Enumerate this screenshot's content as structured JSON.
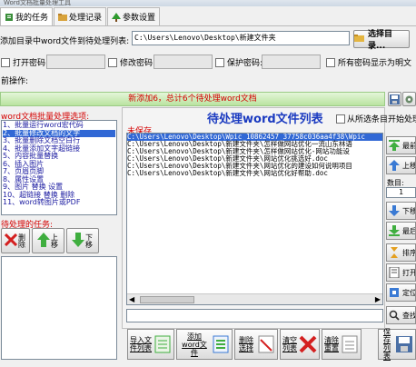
{
  "window": {
    "title": "Word文档批量处理工具"
  },
  "tabs": [
    {
      "label": "我的任务"
    },
    {
      "label": "处理记录"
    },
    {
      "label": "参数设置"
    }
  ],
  "add_dir": {
    "label": "添加目录中word文件到待处理列表:",
    "path": "C:\\Users\\Lenovo\\Desktop\\新建文件夹",
    "select_button": "选择目录..."
  },
  "passwords": {
    "open_label": "打开密码:",
    "modify_label": "修改密码:",
    "protect_label": "保护密码:",
    "show_plain_label": "所有密码显示为明文"
  },
  "operation_label": "前操作:",
  "status_bar": {
    "text": "新添加6，总计6个待处理word文档"
  },
  "left": {
    "title": "word文档批量处理选项:",
    "options": [
      "1、批量运行word宏代码",
      "2、批量修改文档的文字",
      "3、批量删除文档空白行",
      "4、批量添加文字超链接",
      "5、内容批量替换",
      "6、插入图片",
      "7、页眉页脚",
      "8、属性设置",
      "9、图片 替换 设置",
      "10、超链接 替换 删除",
      "11、word转图片或PDF"
    ],
    "tasks_title": "待处理的任务:",
    "delete_label": "删除",
    "move_up_label": "上移",
    "move_down_label": "下移"
  },
  "center": {
    "title": "待处理word文件列表",
    "from_selected_label": "从所选条目开始处理",
    "unsaved_label": "未保存",
    "files": [
      "C:\\Users\\Lenovo\\Desktop\\Wpic_10862457_37758c036aa4f38\\Wpic",
      "C:\\Users\\Lenovo\\Desktop\\新建文件夹\\怎样做网站优化一流山东林语",
      "C:\\Users\\Lenovo\\Desktop\\新建文件夹\\怎样做网站优化-网站功能设",
      "C:\\Users\\Lenovo\\Desktop\\新建文件夹\\网站优化挑选好.doc",
      "C:\\Users\\Lenovo\\Desktop\\新建文件夹\\网站优化的建设如何说明项目",
      "C:\\Users\\Lenovo\\Desktop\\新建文件夹\\网站优化好帮助.doc"
    ]
  },
  "right": {
    "top_label": "最前",
    "up_label": "上移",
    "count_label": "数目:",
    "count_value": "1",
    "down_label": "下移",
    "bottom_label": "最后",
    "sort_label": "排序",
    "open_label": "打开",
    "locate_label": "定位",
    "find_label": "查找"
  },
  "bottom": {
    "import_label": "导入文件列表",
    "add_word_label": "添加word文件",
    "delete_label": "删除选择",
    "clear_label": "清空列表",
    "reset_label": "清除重置",
    "save_label": "保存列表"
  }
}
